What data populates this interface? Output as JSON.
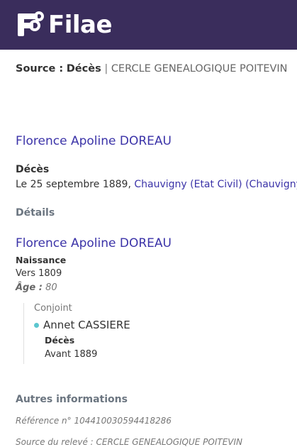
{
  "brand": {
    "name": "Filae"
  },
  "source": {
    "label": "Source :",
    "type": "Décès",
    "separator": "|",
    "org": "CERCLE GENEALOGIQUE POITEVIN"
  },
  "record": {
    "name": "Florence Apoline DOREAU",
    "event_heading": "Décès",
    "event_date_prefix": "Le 25 septembre 1889,",
    "event_place": "Chauvigny (Etat Civil) (Chauvigny,"
  },
  "details": {
    "heading": "Détails",
    "person_name": "Florence Apoline DOREAU",
    "birth_label": "Naissance",
    "birth_date": "Vers 1809",
    "age_label": "Âge :",
    "age_value": "80"
  },
  "spouse": {
    "label": "Conjoint",
    "name": "Annet CASSIERE",
    "event_label": "Décès",
    "event_date": "Avant 1889"
  },
  "other": {
    "heading": "Autres informations",
    "reference": "Référence n° 104410030594418286",
    "source_note": "Source du relevé : CERCLE GENEALOGIQUE POITEVIN"
  },
  "colors": {
    "header": "#3a2d5c",
    "link": "#3b33a8",
    "dot": "#5cc6cf"
  }
}
